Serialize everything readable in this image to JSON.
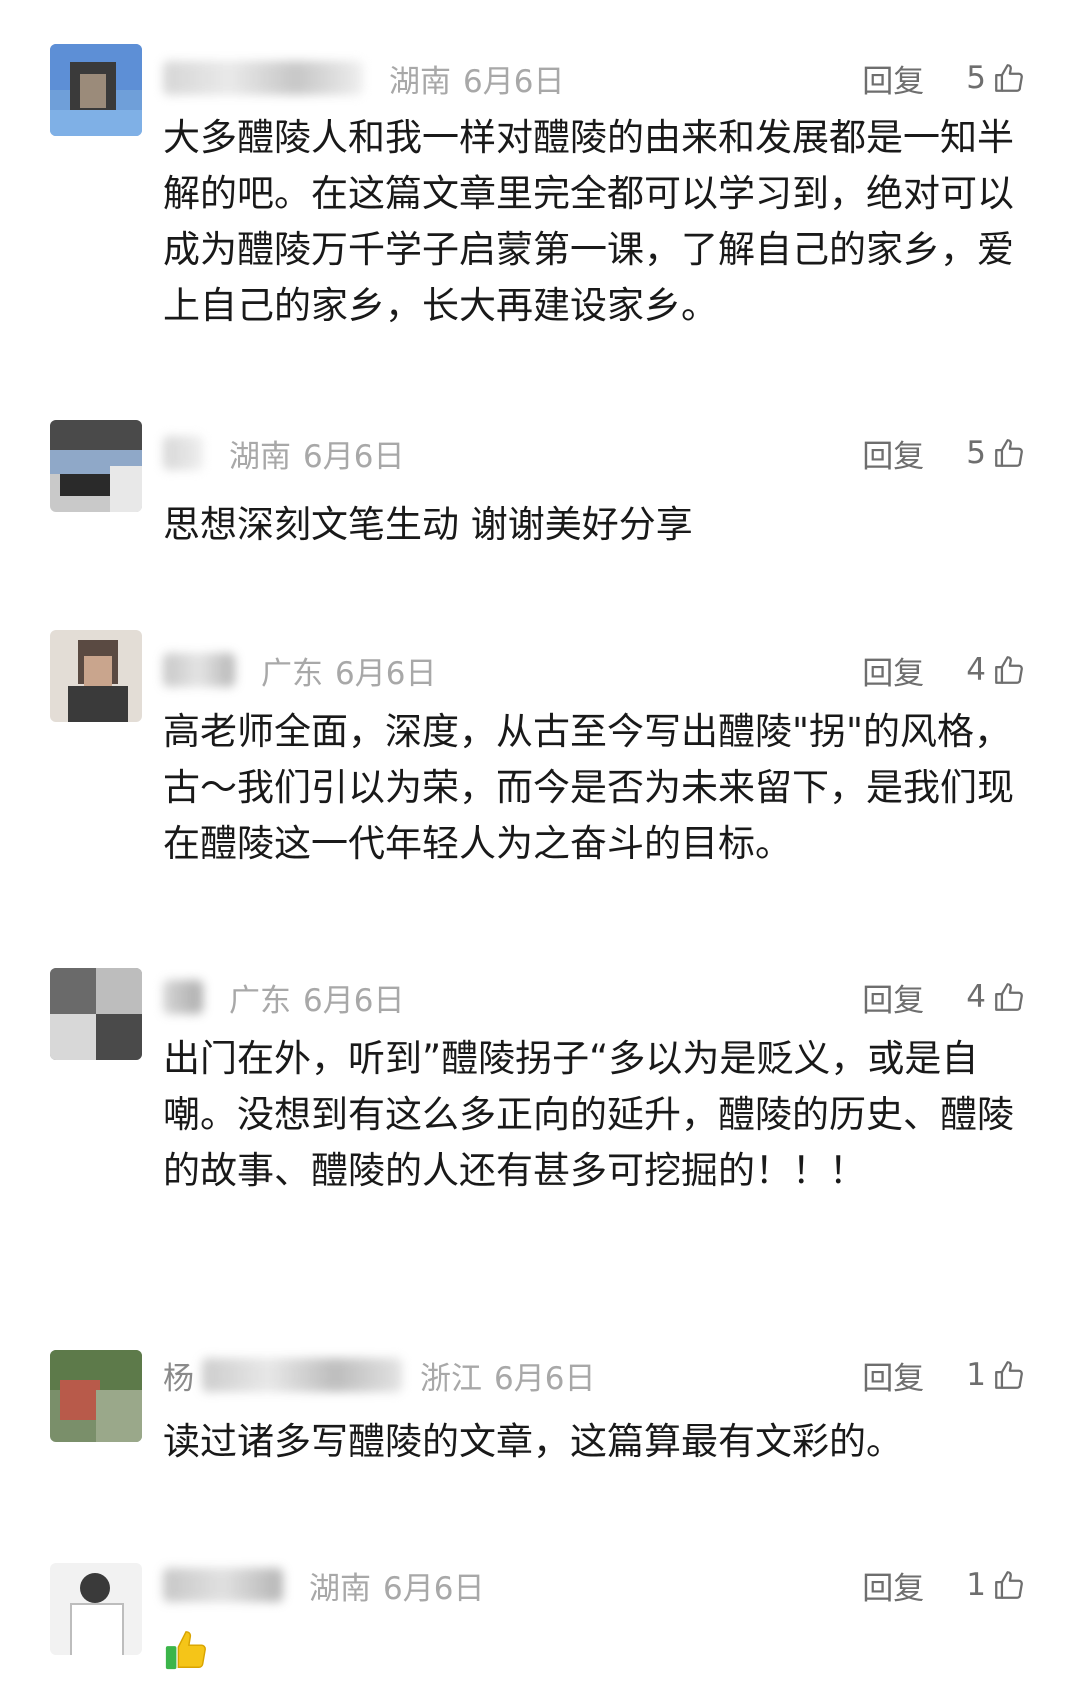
{
  "comments": [
    {
      "name": "",
      "region": "湖南",
      "date": "6月6日",
      "reply_label": "回复",
      "likes": "5",
      "text": "大多醴陵人和我一样对醴陵的由来和发展都是一知半解的吧。在这篇文章里完全都可以学习到，绝对可以成为醴陵万千学子启蒙第一课，了解自己的家乡，爱上自己的家乡，长大再建设家乡。"
    },
    {
      "name": "",
      "region": "湖南",
      "date": "6月6日",
      "reply_label": "回复",
      "likes": "5",
      "text": "思想深刻文笔生动 谢谢美好分享"
    },
    {
      "name": "",
      "region": "广东",
      "date": "6月6日",
      "reply_label": "回复",
      "likes": "4",
      "text": "高老师全面，深度，从古至今写出醴陵\"拐\"的风格，古～我们引以为荣，而今是否为未来留下，是我们现在醴陵这一代年轻人为之奋斗的目标。"
    },
    {
      "name": "",
      "region": "广东",
      "date": "6月6日",
      "reply_label": "回复",
      "likes": "4",
      "text": "出门在外，听到”醴陵拐子“多以为是贬义，或是自嘲。没想到有这么多正向的延升，醴陵的历史、醴陵的故事、醴陵的人还有甚多可挖掘的！！！"
    },
    {
      "name": "杨",
      "region": "浙江",
      "date": "6月6日",
      "reply_label": "回复",
      "likes": "1",
      "text": "读过诸多写醴陵的文章，这篇算最有文彩的。"
    },
    {
      "name": "",
      "region": "湖南",
      "date": "6月6日",
      "reply_label": "回复",
      "likes": "1",
      "text": ""
    }
  ],
  "colors": {
    "text": "#191919",
    "meta": "#a8a8a8",
    "action": "#6e6e6e",
    "thumb_yellow": "#f5c518",
    "thumb_green": "#3bb54a"
  },
  "icons": {
    "like": "thumbs-up-outline-icon",
    "emoji": "thumbs-up-emoji-icon"
  }
}
